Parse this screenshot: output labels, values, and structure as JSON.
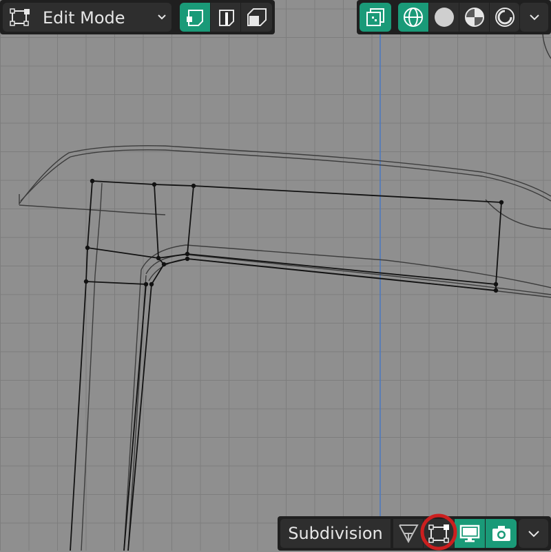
{
  "header": {
    "mode_label": "Edit Mode",
    "select_modes": [
      "vertex-select",
      "edge-select",
      "face-select"
    ],
    "active_select_mode": "vertex-select",
    "overlay_toggle": "mesh-overlay",
    "shading_modes": [
      "wireframe",
      "solid",
      "material-preview",
      "rendered"
    ],
    "active_shading_mode": "wireframe"
  },
  "modifier_bar": {
    "name": "Subdivision",
    "toggles": [
      "on-cage",
      "edit-mode",
      "realtime-display",
      "render"
    ],
    "highlighted_toggle": "edit-mode"
  },
  "colors": {
    "accent": "#1a9a78",
    "viewport_bg": "#8f8f8f",
    "grid_line": "#7d7d7d",
    "axis_line": "#4a78c0",
    "highlight_circle": "#cc1f1f"
  }
}
